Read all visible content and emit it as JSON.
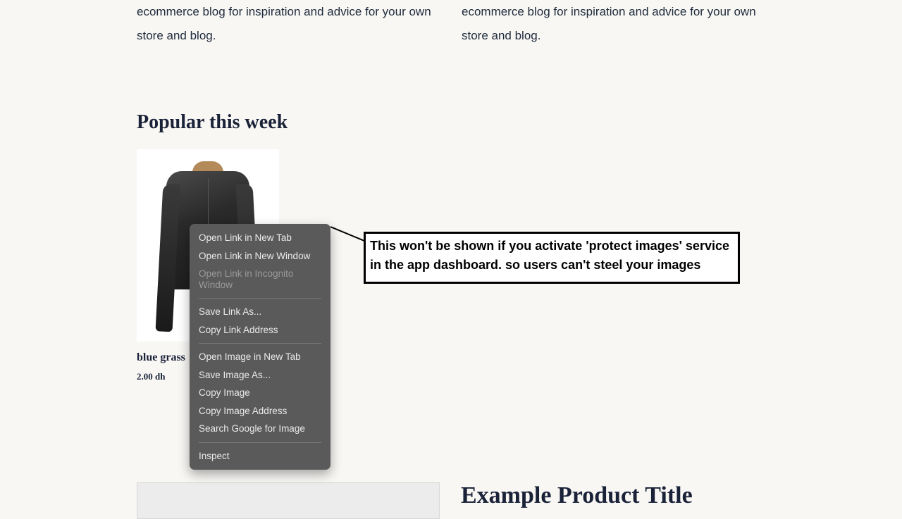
{
  "blog": {
    "left": "ecommerce blog for inspiration and advice for your own store and blog.",
    "right": "ecommerce blog for inspiration and advice for your own store and blog."
  },
  "popular": {
    "heading": "Popular this week",
    "product": {
      "title": "blue grass",
      "price": "2.00 dh"
    }
  },
  "context_menu": {
    "items": [
      {
        "label": "Open Link in New Tab",
        "disabled": false
      },
      {
        "label": "Open Link in New Window",
        "disabled": false
      },
      {
        "label": "Open Link in Incognito Window",
        "disabled": true
      }
    ],
    "group2": [
      {
        "label": "Save Link As..."
      },
      {
        "label": "Copy Link Address"
      }
    ],
    "group3": [
      {
        "label": "Open Image in New Tab"
      },
      {
        "label": "Save Image As..."
      },
      {
        "label": "Copy Image"
      },
      {
        "label": "Copy Image Address"
      },
      {
        "label": "Search Google for Image"
      }
    ],
    "group4": [
      {
        "label": "Inspect"
      }
    ]
  },
  "callout": {
    "text": "This won't be shown if you activate 'protect images' service in the app dashboard. so users can't steel your images"
  },
  "example": {
    "title": "Example Product Title"
  }
}
